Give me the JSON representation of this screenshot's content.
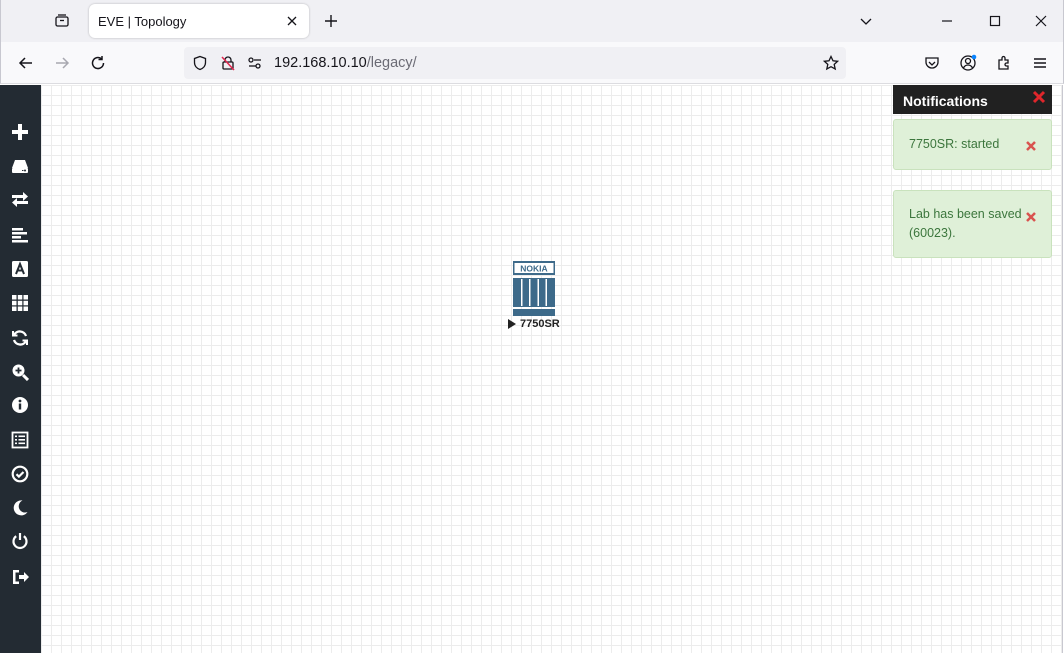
{
  "browser": {
    "tab_title": "EVE | Topology",
    "url_host": "192.168.10.10",
    "url_path": "/legacy/"
  },
  "sidebar": {
    "items": [
      {
        "icon": "plus-icon",
        "name": "add-object"
      },
      {
        "icon": "hdd-icon",
        "name": "nodes"
      },
      {
        "icon": "exchange-icon",
        "name": "networks"
      },
      {
        "icon": "align-left-icon",
        "name": "startup-configs"
      },
      {
        "icon": "font-icon",
        "name": "text-objects"
      },
      {
        "icon": "grid-icon",
        "name": "pictures"
      },
      {
        "icon": "refresh-icon",
        "name": "refresh-topology"
      },
      {
        "icon": "zoom-in-icon",
        "name": "zoom"
      },
      {
        "icon": "info-icon",
        "name": "lab-details"
      },
      {
        "icon": "list-icon",
        "name": "workbook"
      },
      {
        "icon": "check-circle-icon",
        "name": "lock-lab"
      },
      {
        "icon": "moon-icon",
        "name": "dark-mode"
      },
      {
        "icon": "power-icon",
        "name": "close-lab"
      },
      {
        "icon": "logout-icon",
        "name": "logout"
      }
    ]
  },
  "node": {
    "label": "7750SR",
    "brand": "NOKIA",
    "status": "running"
  },
  "notifications": {
    "title": "Notifications",
    "items": [
      {
        "text": "7750SR: started"
      },
      {
        "text": "Lab has been saved (60023)."
      }
    ]
  },
  "colors": {
    "sidebar_bg": "#232b33",
    "node_blue": "#3d6a8a",
    "notif_success_bg": "#dff0d8",
    "notif_success_text": "#3c763d",
    "close_red": "#d9534f"
  }
}
